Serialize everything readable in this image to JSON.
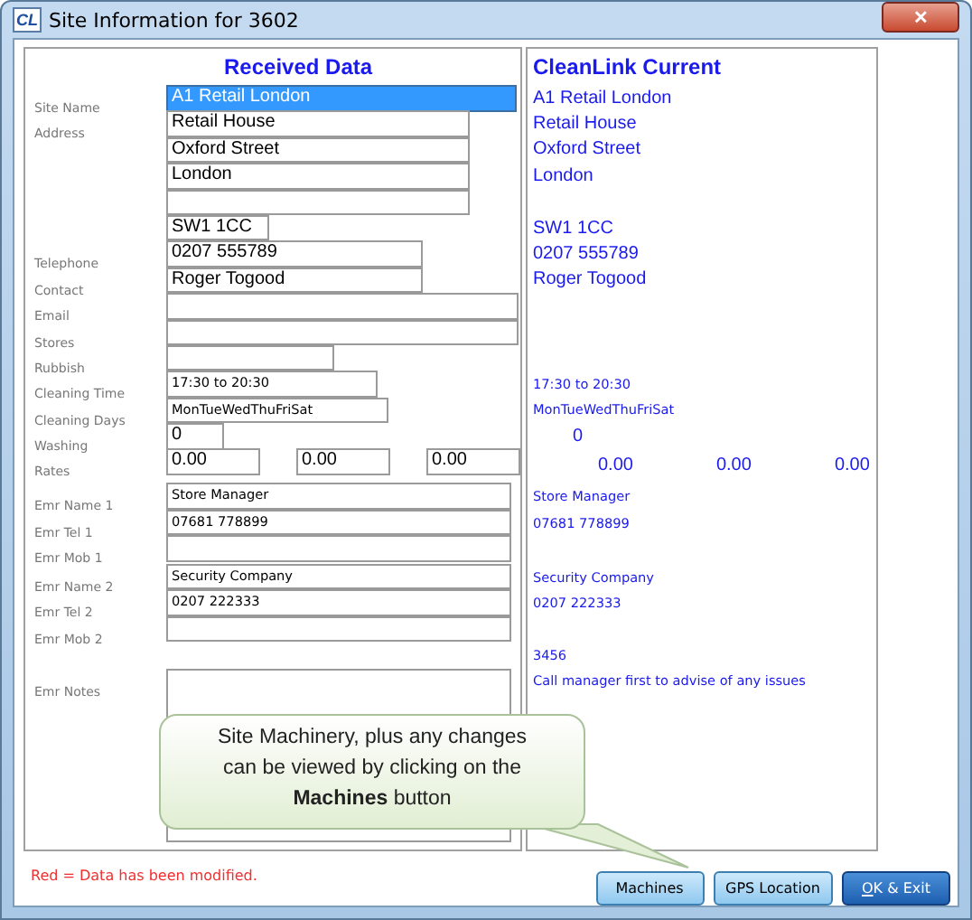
{
  "window": {
    "app_icon_text": "CL",
    "title": "Site Information for 3602",
    "close_glyph": "✕"
  },
  "received": {
    "heading": "Received Data"
  },
  "current": {
    "heading": "CleanLink Current"
  },
  "rows": [
    {
      "kind": "big",
      "label": "Site Name",
      "value": "A1 Retail London",
      "current": "A1 Retail London",
      "focused": true
    },
    {
      "kind": "big",
      "label": "Address",
      "value": "Retail House",
      "current": "Retail House",
      "focused": false
    },
    {
      "kind": "big",
      "value": "Oxford Street",
      "current": "Oxford Street",
      "focused": false
    },
    {
      "kind": "big",
      "value": "London",
      "current": "London",
      "focused": false
    },
    {
      "kind": "big",
      "focused": false
    },
    {
      "kind": "big",
      "value": "SW1 1CC",
      "current": "SW1 1CC",
      "focused": false
    },
    {
      "kind": "big",
      "label": "Telephone",
      "value": "0207 555789",
      "current": "0207 555789",
      "focused": false
    },
    {
      "kind": "big",
      "label": "Contact",
      "value": "Roger Togood",
      "current": "Roger Togood",
      "focused": false
    },
    {
      "kind": "big",
      "label": "Email",
      "focused": false
    },
    {
      "kind": "big",
      "label": "Stores",
      "focused": false
    },
    {
      "kind": "big",
      "label": "Rubbish",
      "focused": false
    },
    {
      "kind": "small",
      "label": "Cleaning Time",
      "value": "17:30 to 20:30",
      "current": "17:30 to 20:30",
      "focused": false
    },
    {
      "kind": "small",
      "label": "Cleaning Days",
      "value": "MonTueWedThuFriSat",
      "current": "MonTueWedThuFriSat",
      "focused": false
    },
    {
      "kind": "big",
      "label": "Washing",
      "value": "0",
      "current": "0",
      "focused": false
    },
    {
      "kind": "rates",
      "label": "Rates",
      "values": [
        "0.00",
        "0.00",
        "0.00"
      ],
      "currents": [
        "0.00",
        "0.00",
        "0.00"
      ]
    },
    {
      "kind": "small",
      "label": "Emr Name 1",
      "value": "Store Manager",
      "current": "Store Manager",
      "focused": false
    },
    {
      "kind": "small",
      "label": "Emr Tel 1",
      "value": "07681 778899",
      "current": "07681 778899",
      "focused": false
    },
    {
      "kind": "small",
      "label": "Emr Mob 1",
      "focused": false
    },
    {
      "kind": "small",
      "label": "Emr Name 2",
      "value": "Security Company",
      "current": "Security Company",
      "focused": false
    },
    {
      "kind": "small",
      "label": "Emr Tel 2",
      "value": "0207 222333",
      "current": "0207 222333",
      "focused": false
    },
    {
      "kind": "small",
      "label": "Emr Mob 2",
      "focused": false
    },
    {
      "kind": "gap",
      "current": "3456"
    },
    {
      "kind": "notes",
      "label": "Emr Notes",
      "current": "Call manager first to advise of any issues",
      "focused": false
    }
  ],
  "legend": "Red = Data has been modified.",
  "callout": "Site Machinery, plus any changes can be viewed by clicking on the **Machines** button",
  "buttons": [
    {
      "label": "Machines",
      "default": false
    },
    {
      "label": "GPS Location",
      "default": false
    },
    {
      "label": "OK & Exit",
      "default": true
    }
  ]
}
